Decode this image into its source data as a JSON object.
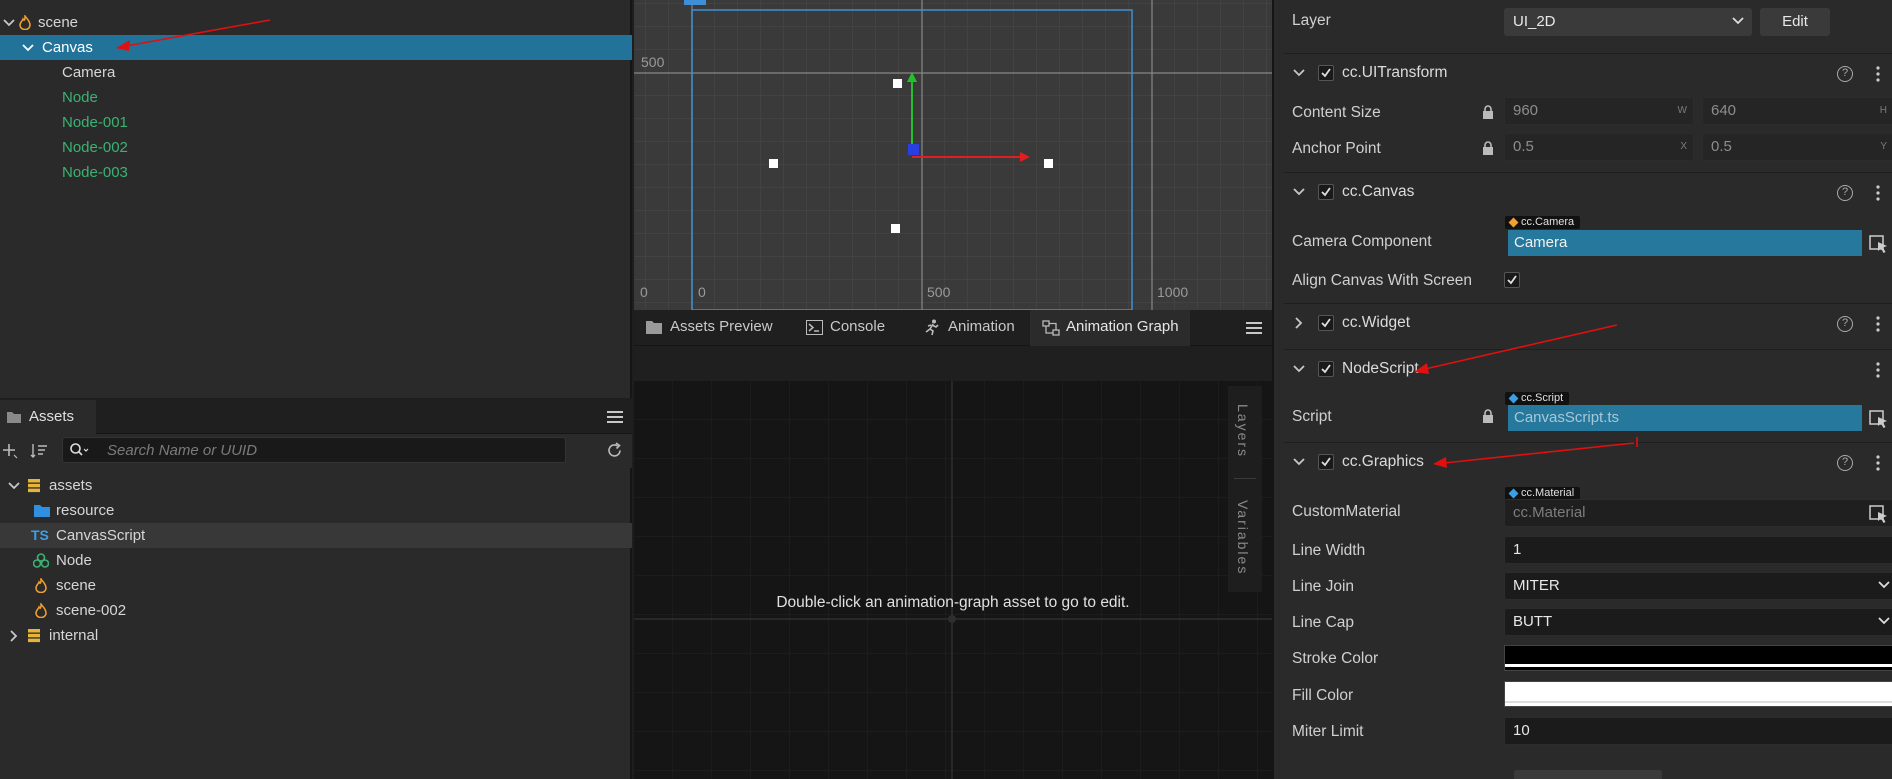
{
  "hierarchy": {
    "items": [
      {
        "label": "scene",
        "level": 0,
        "expanded": true,
        "icon": "scene-flame-icon"
      },
      {
        "label": "Canvas",
        "level": 1,
        "expanded": true,
        "selected": true
      },
      {
        "label": "Camera",
        "level": 2
      },
      {
        "label": "Node",
        "level": 2,
        "prefab": true
      },
      {
        "label": "Node-001",
        "level": 2,
        "prefab": true
      },
      {
        "label": "Node-002",
        "level": 2,
        "prefab": true
      },
      {
        "label": "Node-003",
        "level": 2,
        "prefab": true
      }
    ]
  },
  "assets": {
    "tab_label": "Assets",
    "search_placeholder": "Search Name or UUID",
    "items": [
      {
        "label": "assets",
        "level": 0,
        "expanded": true,
        "icon": "database-icon"
      },
      {
        "label": "resource",
        "level": 1,
        "icon": "folder-icon"
      },
      {
        "label": "CanvasScript",
        "level": 1,
        "icon": "typescript-icon",
        "icon_text": "TS",
        "highlighted": true
      },
      {
        "label": "Node",
        "level": 1,
        "icon": "prefab-icon"
      },
      {
        "label": "scene",
        "level": 1,
        "icon": "scene-flame-icon"
      },
      {
        "label": "scene-002",
        "level": 1,
        "icon": "scene-flame-icon"
      },
      {
        "label": "internal",
        "level": 0,
        "expanded": false,
        "icon": "database-icon"
      }
    ]
  },
  "scene_view": {
    "axis_labels": {
      "y_500": "500",
      "x_0_left": "0",
      "x_0": "0",
      "x_500": "500",
      "x_1000": "1000"
    }
  },
  "bottom_tabs": {
    "tabs": [
      {
        "label": "Assets Preview",
        "icon": "image-icon"
      },
      {
        "label": "Console",
        "icon": "terminal-icon"
      },
      {
        "label": "Animation",
        "icon": "running-icon"
      },
      {
        "label": "Animation Graph",
        "icon": "graph-icon",
        "active": true
      }
    ],
    "graph_message": "Double-click an animation-graph asset to go to edit.",
    "side_tabs": {
      "layers": "Layers",
      "variables": "Variables"
    }
  },
  "inspector": {
    "layer": {
      "label": "Layer",
      "value": "UI_2D",
      "edit_label": "Edit"
    },
    "ui_transform": {
      "name": "cc.UITransform",
      "content_size_label": "Content Size",
      "width": "960",
      "width_suffix": "W",
      "height": "640",
      "height_suffix": "H",
      "anchor_label": "Anchor Point",
      "anchor_x": "0.5",
      "anchor_x_suffix": "X",
      "anchor_y": "0.5",
      "anchor_y_suffix": "Y"
    },
    "canvas": {
      "name": "cc.Canvas",
      "camera_label": "Camera Component",
      "camera_tag": "cc.Camera",
      "camera_value": "Camera",
      "align_label": "Align Canvas With Screen"
    },
    "widget": {
      "name": "cc.Widget"
    },
    "node_script": {
      "name": "NodeScript",
      "script_label": "Script",
      "script_tag": "cc.Script",
      "script_value": "CanvasScript.ts"
    },
    "graphics": {
      "name": "cc.Graphics",
      "custom_material_label": "CustomMaterial",
      "material_tag": "cc.Material",
      "material_value": "cc.Material",
      "line_width_label": "Line Width",
      "line_width": "1",
      "line_join_label": "Line Join",
      "line_join": "MITER",
      "line_cap_label": "Line Cap",
      "line_cap": "BUTT",
      "stroke_color_label": "Stroke Color",
      "stroke_color": "#000000",
      "fill_color_label": "Fill Color",
      "fill_color": "#ffffff",
      "miter_limit_label": "Miter Limit",
      "miter_limit": "10"
    }
  },
  "colors": {
    "selection": "#227399",
    "prefab_text": "#3bb273",
    "annotation_arrow": "#e01010"
  }
}
